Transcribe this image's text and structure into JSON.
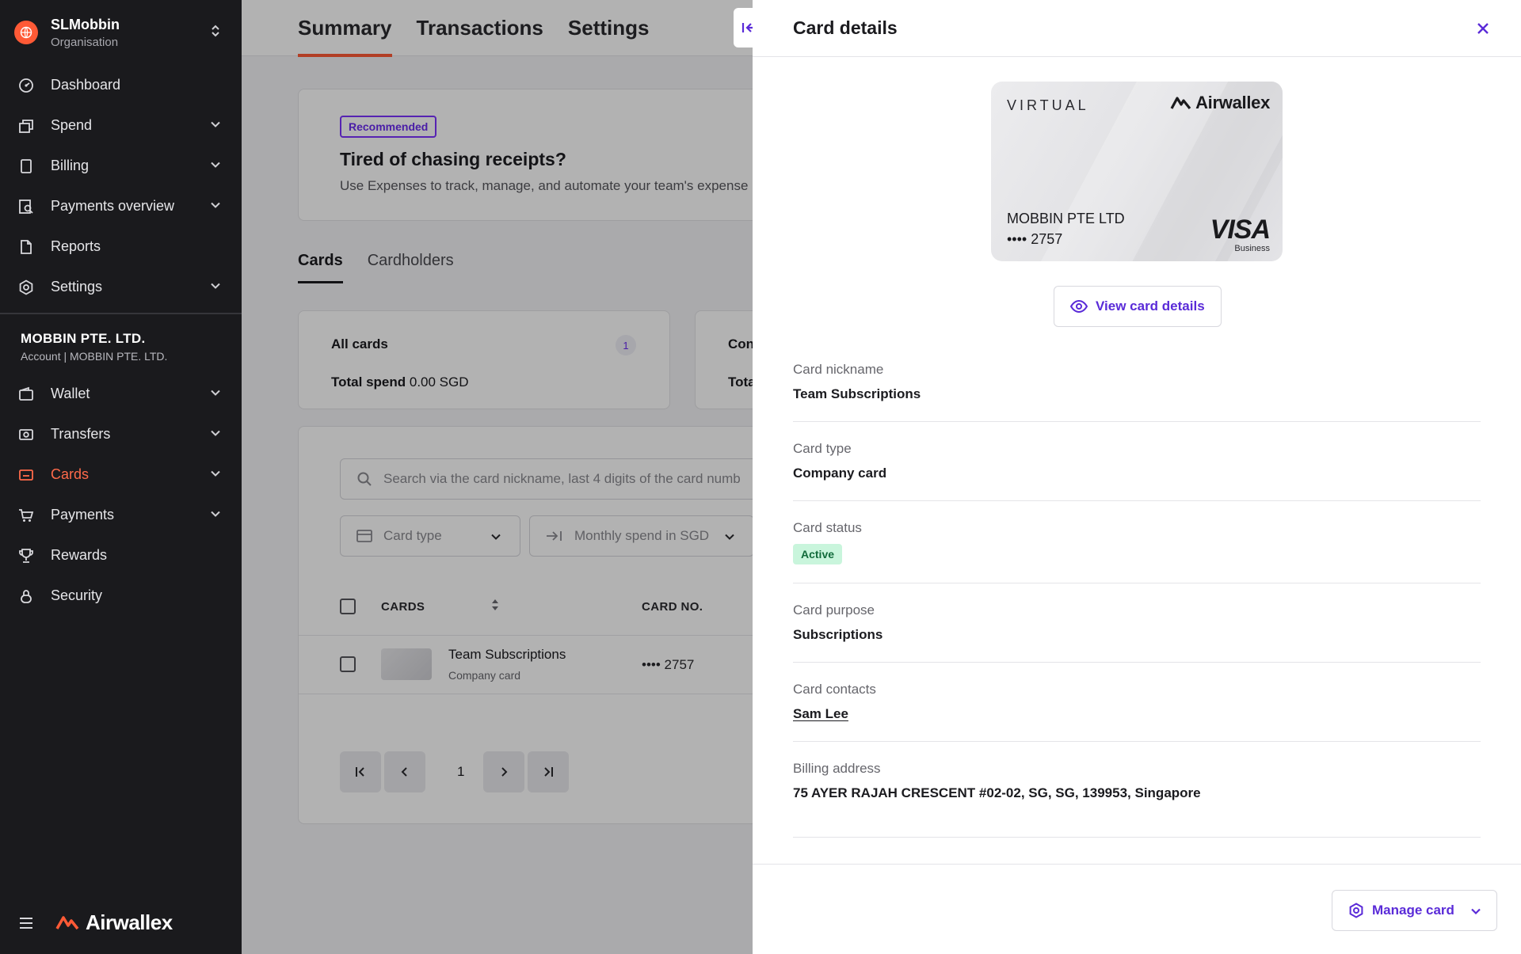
{
  "sidebar": {
    "org_name": "SLMobbin",
    "org_sub": "Organisation",
    "nav_top": [
      {
        "label": "Dashboard",
        "icon": "dashboard-icon",
        "chev": false
      },
      {
        "label": "Spend",
        "icon": "spend-icon",
        "chev": true
      },
      {
        "label": "Billing",
        "icon": "billing-icon",
        "chev": true
      },
      {
        "label": "Payments overview",
        "icon": "payments-overview-icon",
        "chev": true
      },
      {
        "label": "Reports",
        "icon": "reports-icon",
        "chev": false
      },
      {
        "label": "Settings",
        "icon": "settings-icon",
        "chev": true
      }
    ],
    "account_name": "MOBBIN PTE. LTD.",
    "account_sub": "Account | MOBBIN PTE. LTD.",
    "nav_account": [
      {
        "label": "Wallet",
        "icon": "wallet-icon",
        "chev": true
      },
      {
        "label": "Transfers",
        "icon": "transfers-icon",
        "chev": true
      },
      {
        "label": "Cards",
        "icon": "cards-icon",
        "chev": true,
        "active": true
      },
      {
        "label": "Payments",
        "icon": "cart-icon",
        "chev": true
      },
      {
        "label": "Rewards",
        "icon": "trophy-icon",
        "chev": false
      },
      {
        "label": "Security",
        "icon": "lock-icon",
        "chev": false
      }
    ],
    "logo_text": "Airwallex"
  },
  "main": {
    "tabs": [
      "Summary",
      "Transactions",
      "Settings"
    ],
    "active_tab": "Summary",
    "promo": {
      "badge": "Recommended",
      "title": "Tired of chasing receipts?",
      "desc": "Use Expenses to track, manage, and automate your team's expense"
    },
    "subtabs": [
      "Cards",
      "Cardholders"
    ],
    "stats": [
      {
        "title": "All cards",
        "count": "1",
        "spend_label": "Total spend",
        "spend_value": "0.00 SGD"
      },
      {
        "title": "Con",
        "spend_label": "Tota"
      }
    ],
    "search_placeholder": "Search via the card nickname, last 4 digits of the card numb",
    "filters": [
      "Card type",
      "Monthly spend in SGD"
    ],
    "columns": [
      "CARDS",
      "CARD NO."
    ],
    "rows": [
      {
        "name": "Team Subscriptions",
        "sub": "Company card",
        "card_no": "•••• 2757"
      }
    ],
    "page": "1"
  },
  "drawer": {
    "title": "Card details",
    "card": {
      "label": "VIRTUAL",
      "brand": "Airwallex",
      "holder": "MOBBIN PTE LTD",
      "number": "•••• 2757",
      "network": "VISA",
      "network_sub": "Business"
    },
    "view_button": "View card details",
    "fields": [
      {
        "label": "Card nickname",
        "value": "Team Subscriptions"
      },
      {
        "label": "Card type",
        "value": "Company card"
      },
      {
        "label": "Card status",
        "value": "Active"
      },
      {
        "label": "Card purpose",
        "value": "Subscriptions"
      },
      {
        "label": "Card contacts",
        "value": "Sam Lee"
      },
      {
        "label": "Billing address",
        "value": "75 AYER RAJAH CRESCENT #02-02, SG, SG, 139953, Singapore"
      }
    ],
    "manage_button": "Manage card"
  },
  "colors": {
    "accent": "#ff5a36",
    "purple": "#5a2bd8",
    "sidebar_bg": "#1a1a1d",
    "status_active_bg": "#c9f5dc"
  }
}
